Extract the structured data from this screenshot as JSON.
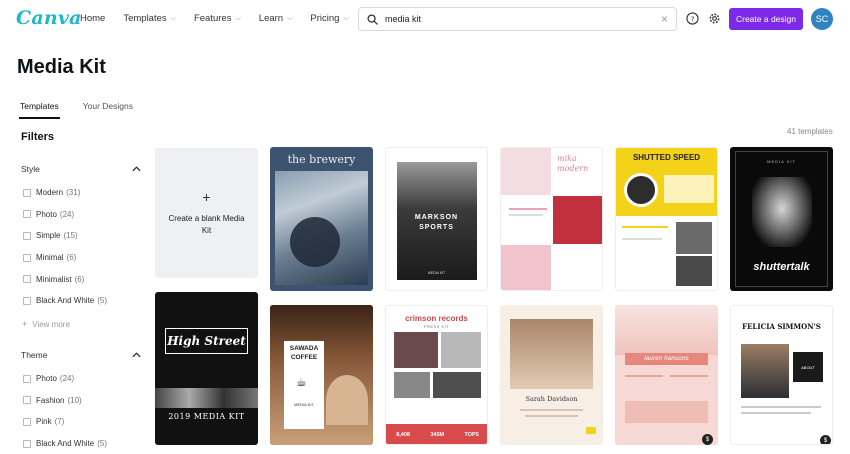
{
  "header": {
    "logo": "Canva",
    "nav": [
      "Home",
      "Templates",
      "Features",
      "Learn",
      "Pricing"
    ],
    "search_value": "media kit",
    "create_label": "Create a design",
    "avatar_initials": "SC"
  },
  "page": {
    "title": "Media Kit",
    "tabs": [
      "Templates",
      "Your Designs"
    ],
    "result_count": "41 templates"
  },
  "filters": {
    "title": "Filters",
    "style": {
      "label": "Style",
      "items": [
        {
          "name": "Modern",
          "count": "(31)"
        },
        {
          "name": "Photo",
          "count": "(24)"
        },
        {
          "name": "Simple",
          "count": "(15)"
        },
        {
          "name": "Minimal",
          "count": "(6)"
        },
        {
          "name": "Minimalist",
          "count": "(6)"
        },
        {
          "name": "Black And White",
          "count": "(5)"
        }
      ],
      "view_more": "View more"
    },
    "theme": {
      "label": "Theme",
      "items": [
        {
          "name": "Photo",
          "count": "(24)"
        },
        {
          "name": "Fashion",
          "count": "(10)"
        },
        {
          "name": "Pink",
          "count": "(7)"
        },
        {
          "name": "Black And White",
          "count": "(5)"
        }
      ]
    }
  },
  "grid": {
    "blank_label": "Create a blank Media Kit",
    "templates": {
      "t1": "the brewery",
      "t2a": "MARKSON",
      "t2b": "SPORTS",
      "t2c": "MEDIA KIT",
      "t3a": "mika",
      "t3b": "modern",
      "t4": "SHUTTED SPEED",
      "t5a": "MEDIA KIT",
      "t5b": "shuttertalk",
      "t6a": "High Street",
      "t6b": "2019 MEDIA KIT",
      "t7a": "SAWADA",
      "t7b": "COFFEE",
      "t7c": "MEDIA KIT",
      "t8a": "crimson records",
      "t8b": "PRESS KIT",
      "t8c": "8,408",
      "t8d": "345M",
      "t8e": "TOP5",
      "t9": "Sarah Davidson",
      "t10": "lauren hansons",
      "t11a": "FELICIA SIMMON'S",
      "t11b": "ABOUT"
    },
    "pro_badge": "$"
  },
  "colors": {
    "brand": "#1fb6d0",
    "accent": "#7d2ae8",
    "avatar": "#2e83c2"
  }
}
